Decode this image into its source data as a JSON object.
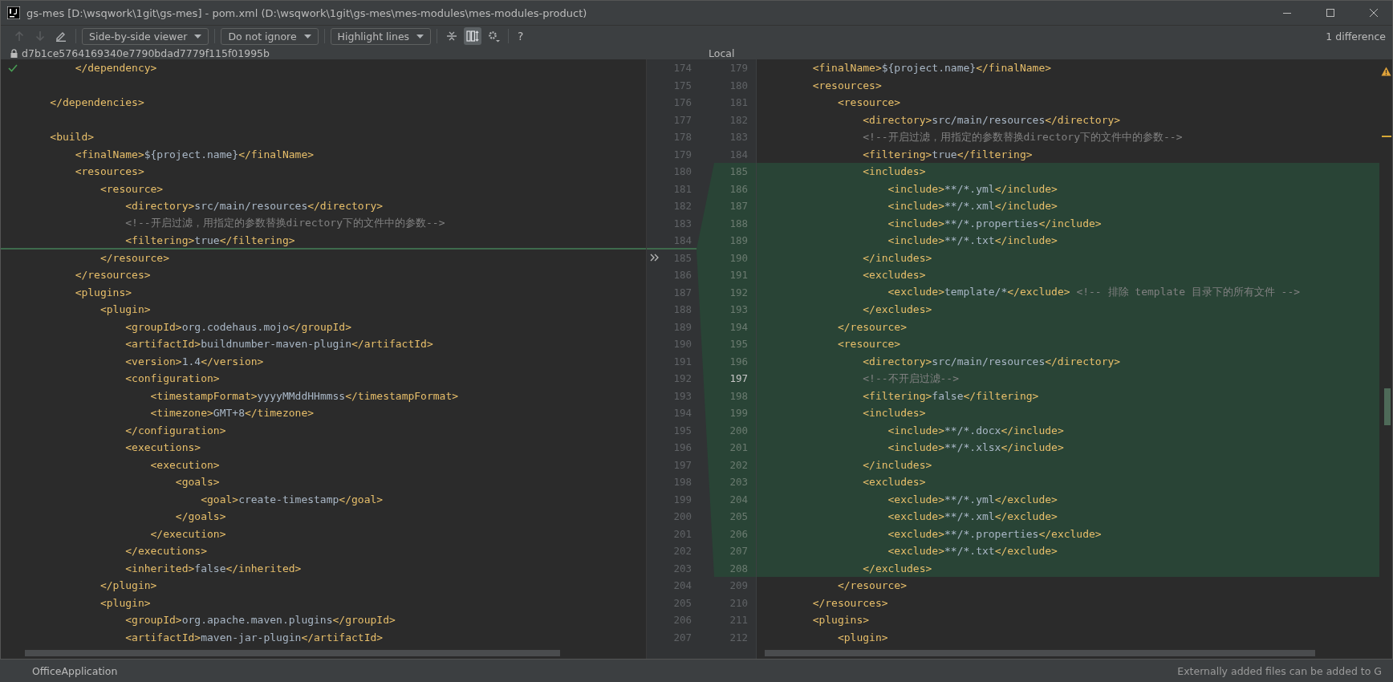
{
  "window": {
    "title": "gs-mes [D:\\wsqwork\\1git\\gs-mes] - pom.xml (D:\\wsqwork\\1git\\gs-mes\\mes-modules\\mes-modules-product)"
  },
  "toolbar": {
    "nav": [
      {
        "kind": "up",
        "disabled": true
      },
      {
        "kind": "down",
        "disabled": true
      },
      {
        "kind": "edit",
        "disabled": false
      }
    ],
    "dropdowns": [
      {
        "label": "Side-by-side viewer"
      },
      {
        "label": "Do not ignore"
      },
      {
        "label": "Highlight lines"
      }
    ],
    "tools": [
      {
        "kind": "collapse",
        "selected": false
      },
      {
        "kind": "sync-scroll",
        "selected": true
      },
      {
        "kind": "settings",
        "selected": false
      }
    ],
    "help": "?",
    "summary": "1 difference"
  },
  "left": {
    "revision": "d7b1ce5764169340e7790bdad7779f115f01995b",
    "lines": [
      {
        "number": "174",
        "text": "        </dependency>",
        "insert_below": false
      },
      {
        "number": "175",
        "insert_below": false
      },
      {
        "number": "176",
        "text": "    </dependencies>",
        "insert_below": false
      },
      {
        "number": "177",
        "insert_below": false
      },
      {
        "number": "178",
        "text": "    <build>",
        "insert_below": false
      },
      {
        "number": "179",
        "text": "        <finalName>${project.name}</finalName>",
        "insert_below": false
      },
      {
        "number": "180",
        "text": "        <resources>",
        "insert_below": false
      },
      {
        "number": "181",
        "text": "            <resource>",
        "insert_below": false
      },
      {
        "number": "182",
        "text": "                <directory>src/main/resources</directory>",
        "insert_below": false
      },
      {
        "number": "183",
        "text": "                <!--开启过滤，用指定的参数替换directory下的文件中的参数-->",
        "insert_below": false
      },
      {
        "number": "184",
        "text": "                <filtering>true</filtering>",
        "insert_below": true
      },
      {
        "number": "185",
        "text": "            </resource>",
        "insert_below": false
      },
      {
        "number": "186",
        "text": "        </resources>",
        "insert_below": false
      },
      {
        "number": "187",
        "text": "        <plugins>",
        "insert_below": false
      },
      {
        "number": "188",
        "text": "            <plugin>",
        "insert_below": false
      },
      {
        "number": "189",
        "text": "                <groupId>org.codehaus.mojo</groupId>",
        "insert_below": false
      },
      {
        "number": "190",
        "text": "                <artifactId>buildnumber-maven-plugin</artifactId>",
        "insert_below": false
      },
      {
        "number": "191",
        "text": "                <version>1.4</version>",
        "insert_below": false
      },
      {
        "number": "192",
        "text": "                <configuration>",
        "insert_below": false
      },
      {
        "number": "193",
        "text": "                    <timestampFormat>yyyyMMddHHmmss</timestampFormat>",
        "insert_below": false
      },
      {
        "number": "194",
        "text": "                    <timezone>GMT+8</timezone>",
        "insert_below": false
      },
      {
        "number": "195",
        "text": "                </configuration>",
        "insert_below": false
      },
      {
        "number": "196",
        "text": "                <executions>",
        "insert_below": false
      },
      {
        "number": "197",
        "text": "                    <execution>",
        "insert_below": false
      },
      {
        "number": "198",
        "text": "                        <goals>",
        "insert_below": false
      },
      {
        "number": "199",
        "text": "                            <goal>create-timestamp</goal>",
        "insert_below": false
      },
      {
        "number": "200",
        "text": "                        </goals>",
        "insert_below": false
      },
      {
        "number": "201",
        "text": "                    </execution>",
        "insert_below": false
      },
      {
        "number": "202",
        "text": "                </executions>",
        "insert_below": false
      },
      {
        "number": "203",
        "text": "                <inherited>false</inherited>",
        "insert_below": false
      },
      {
        "number": "204",
        "text": "            </plugin>",
        "insert_below": false
      },
      {
        "number": "205",
        "text": "            <plugin>",
        "insert_below": false
      },
      {
        "number": "206",
        "text": "                <groupId>org.apache.maven.plugins</groupId>",
        "insert_below": false
      },
      {
        "number": "207",
        "text": "                <artifactId>maven-jar-plugin</artifactId>",
        "insert_below": false
      }
    ]
  },
  "right": {
    "label": "Local",
    "lines": [
      {
        "number": "179",
        "text": "        <finalName>${project.name}</finalName>",
        "added": false,
        "current": false
      },
      {
        "number": "180",
        "text": "        <resources>",
        "added": false,
        "current": false
      },
      {
        "number": "181",
        "text": "            <resource>",
        "added": false,
        "current": false
      },
      {
        "number": "182",
        "text": "                <directory>src/main/resources</directory>",
        "added": false,
        "current": false
      },
      {
        "number": "183",
        "text": "                <!--开启过滤，用指定的参数替换directory下的文件中的参数-->",
        "added": false,
        "current": false
      },
      {
        "number": "184",
        "text": "                <filtering>true</filtering>",
        "added": false,
        "current": false
      },
      {
        "number": "185",
        "text": "                <includes>",
        "added": true,
        "current": false
      },
      {
        "number": "186",
        "text": "                    <include>**/*.yml</include>",
        "added": true,
        "current": false
      },
      {
        "number": "187",
        "text": "                    <include>**/*.xml</include>",
        "added": true,
        "current": false
      },
      {
        "number": "188",
        "text": "                    <include>**/*.properties</include>",
        "added": true,
        "current": false
      },
      {
        "number": "189",
        "text": "                    <include>**/*.txt</include>",
        "added": true,
        "current": false
      },
      {
        "number": "190",
        "text": "                </includes>",
        "added": true,
        "current": false
      },
      {
        "number": "191",
        "text": "                <excludes>",
        "added": true,
        "current": false
      },
      {
        "number": "192",
        "text": "                    <exclude>template/*</exclude> <!-- 排除 template 目录下的所有文件 -->",
        "added": true,
        "current": false
      },
      {
        "number": "193",
        "text": "                </excludes>",
        "added": true,
        "current": false
      },
      {
        "number": "194",
        "text": "            </resource>",
        "added": true,
        "current": false
      },
      {
        "number": "195",
        "text": "            <resource>",
        "added": true,
        "current": false
      },
      {
        "number": "196",
        "text": "                <directory>src/main/resources</directory>",
        "added": true,
        "current": false
      },
      {
        "number": "197",
        "text": "                <!--不开启过滤-->",
        "added": true,
        "current": true
      },
      {
        "number": "198",
        "text": "                <filtering>false</filtering>",
        "added": true,
        "current": false
      },
      {
        "number": "199",
        "text": "                <includes>",
        "added": true,
        "current": false
      },
      {
        "number": "200",
        "text": "                    <include>**/*.docx</include>",
        "added": true,
        "current": false
      },
      {
        "number": "201",
        "text": "                    <include>**/*.xlsx</include>",
        "added": true,
        "current": false
      },
      {
        "number": "202",
        "text": "                </includes>",
        "added": true,
        "current": false
      },
      {
        "number": "203",
        "text": "                <excludes>",
        "added": true,
        "current": false
      },
      {
        "number": "204",
        "text": "                    <exclude>**/*.yml</exclude>",
        "added": true,
        "current": false
      },
      {
        "number": "205",
        "text": "                    <exclude>**/*.xml</exclude>",
        "added": true,
        "current": false
      },
      {
        "number": "206",
        "text": "                    <exclude>**/*.properties</exclude>",
        "added": true,
        "current": false
      },
      {
        "number": "207",
        "text": "                    <exclude>**/*.txt</exclude>",
        "added": true,
        "current": false
      },
      {
        "number": "208",
        "text": "                </excludes>",
        "added": true,
        "current": false
      },
      {
        "number": "209",
        "text": "            </resource>",
        "added": false,
        "current": false
      },
      {
        "number": "210",
        "text": "        </resources>",
        "added": false,
        "current": false
      },
      {
        "number": "211",
        "text": "        <plugins>",
        "added": false,
        "current": false
      },
      {
        "number": "212",
        "text": "            <plugin>",
        "added": false,
        "current": false
      }
    ]
  },
  "ide_background": {
    "run_tab": "OfficeApplication",
    "notification": "Externally added files can be added to G"
  }
}
